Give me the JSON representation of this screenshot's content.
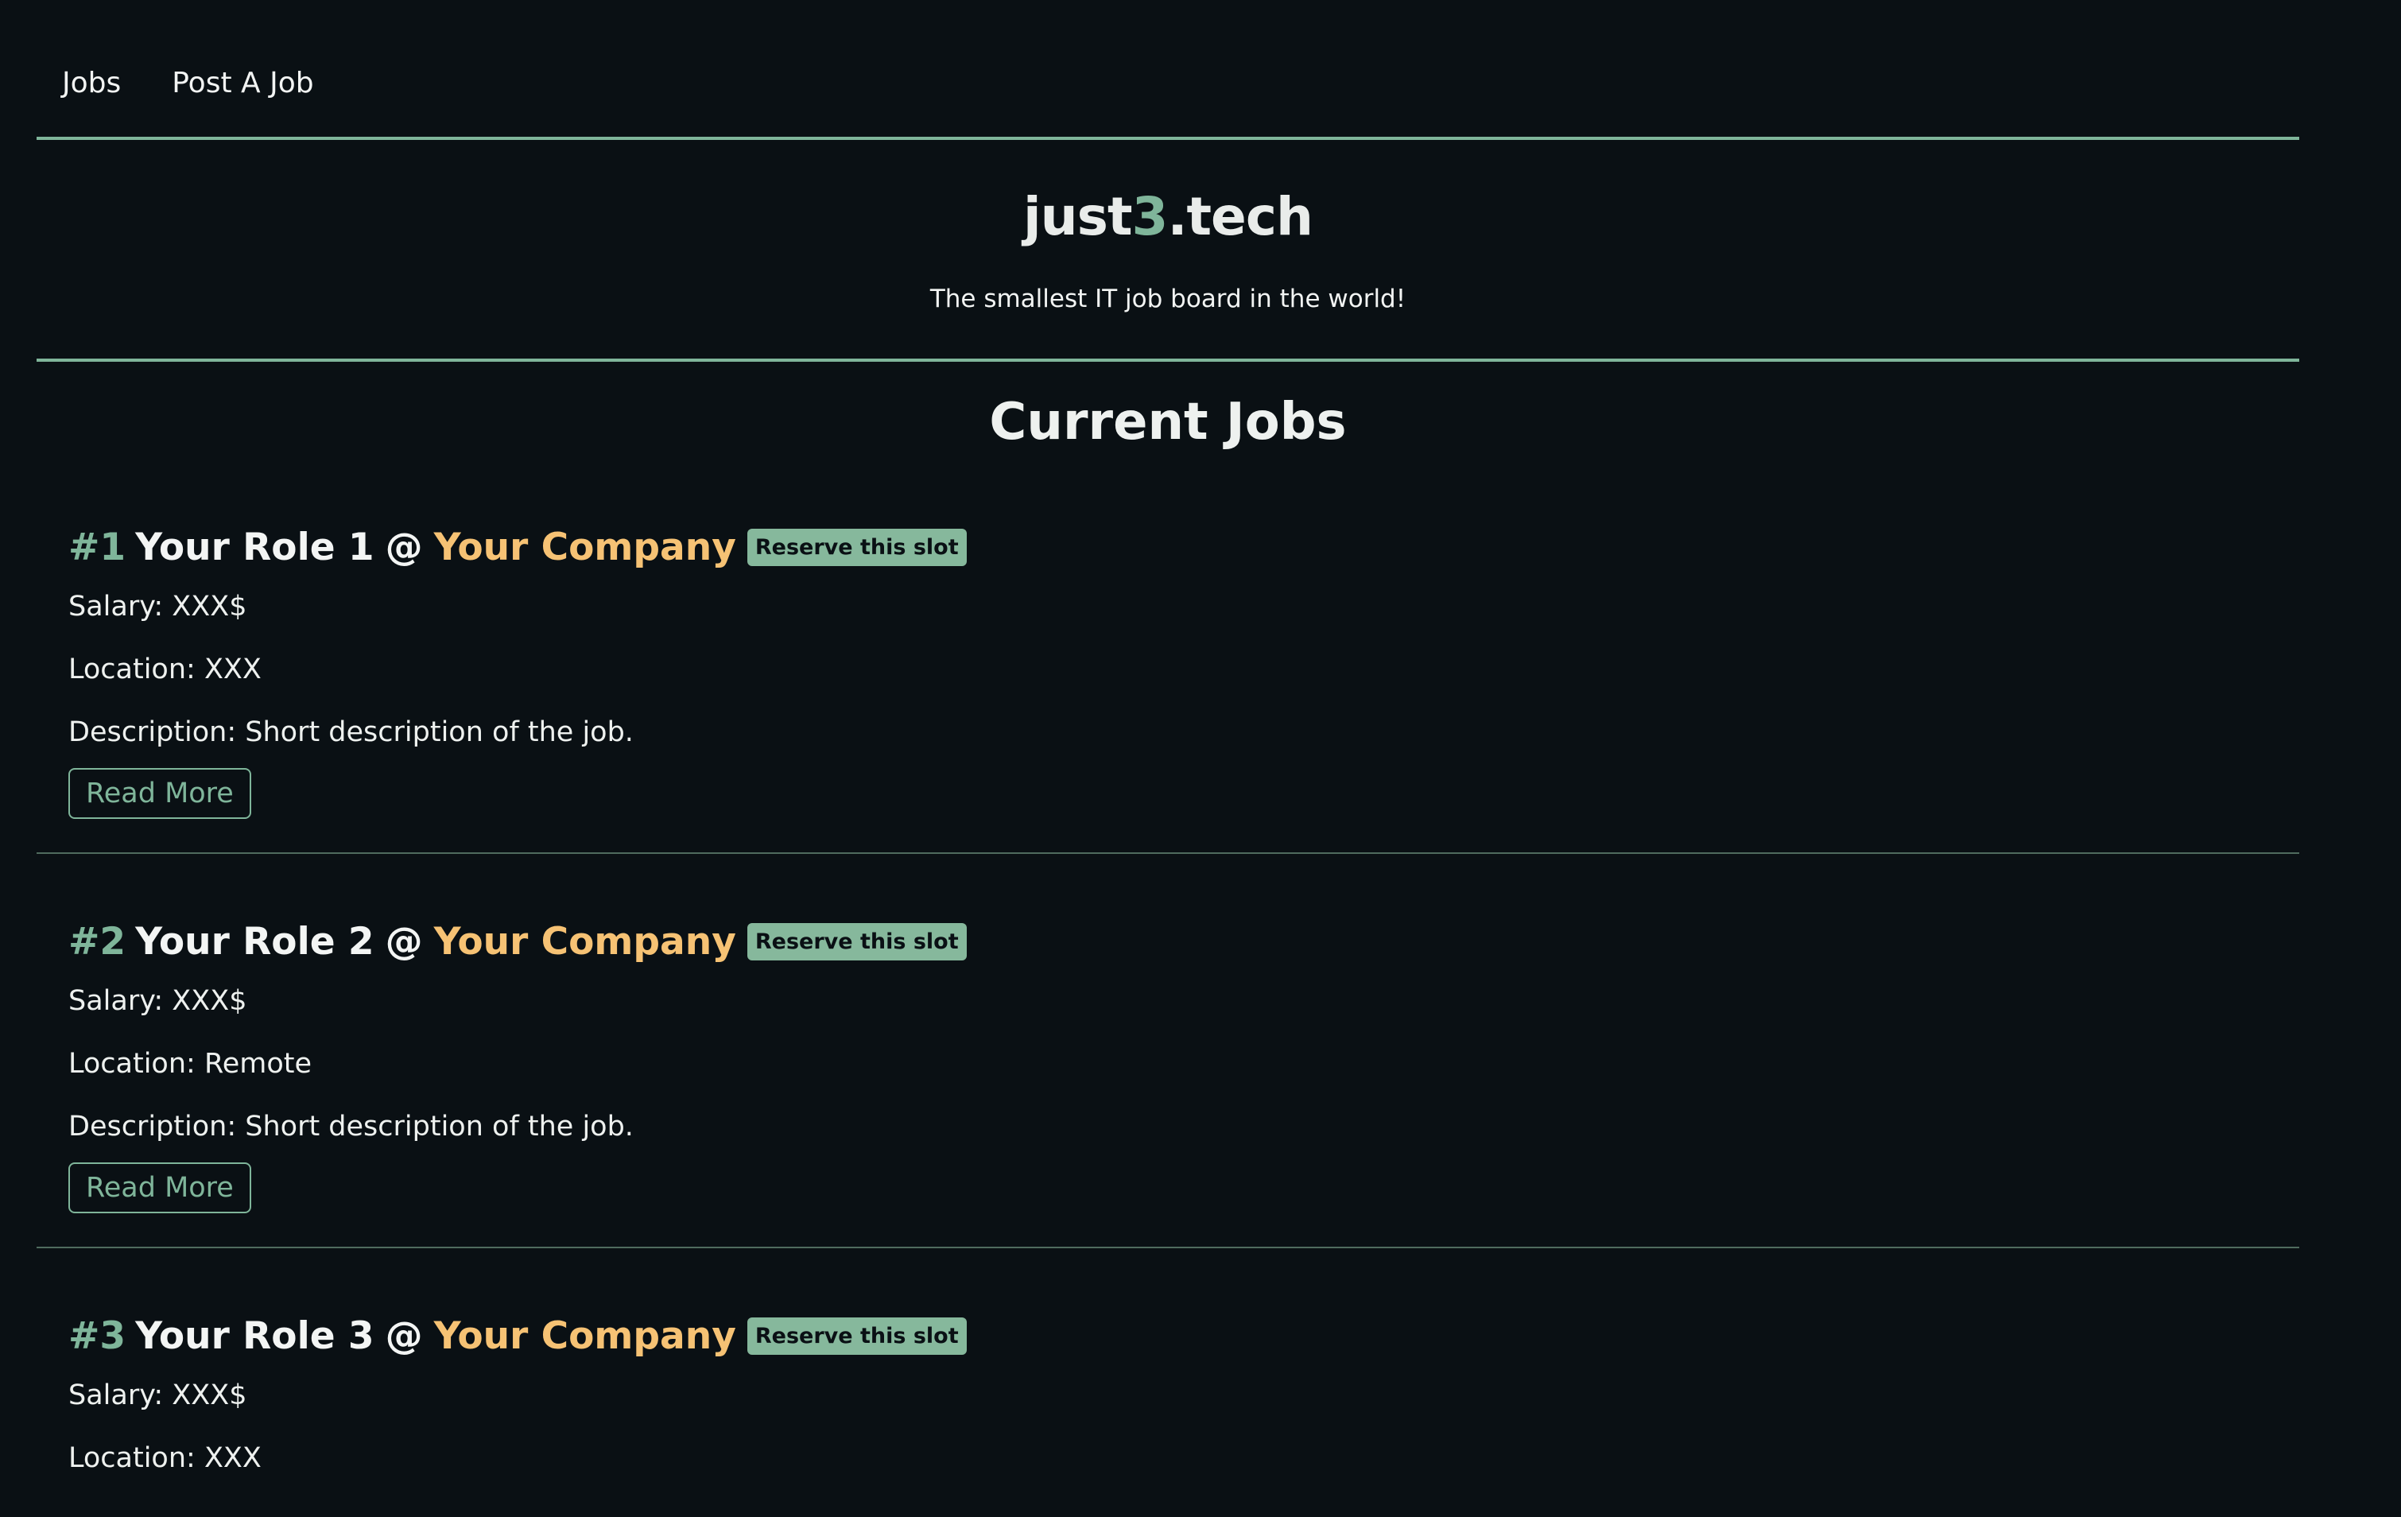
{
  "nav": {
    "jobs_label": "Jobs",
    "post_label": "Post A Job"
  },
  "brand": {
    "prefix": "just",
    "accent": "3",
    "suffix": ".tech",
    "tagline": "The smallest IT job board in the world!"
  },
  "section": {
    "title": "Current Jobs"
  },
  "jobs": [
    {
      "number": "#1",
      "role": "Your Role 1",
      "at": "@",
      "company": "Your Company",
      "badge": "Reserve this slot",
      "salary": "Salary: XXX$",
      "location": "Location: XXX",
      "description": "Description: Short description of the job.",
      "read_more": "Read More"
    },
    {
      "number": "#2",
      "role": "Your Role 2",
      "at": "@",
      "company": "Your Company",
      "badge": "Reserve this slot",
      "salary": "Salary: XXX$",
      "location": "Location: Remote",
      "description": "Description: Short description of the job.",
      "read_more": "Read More"
    },
    {
      "number": "#3",
      "role": "Your Role 3",
      "at": "@",
      "company": "Your Company",
      "badge": "Reserve this slot",
      "salary": "Salary: XXX$",
      "location": "Location: XXX"
    }
  ],
  "colors": {
    "background": "#0a1014",
    "accent_green": "#7fb59a",
    "company_gold": "#f6c274",
    "text": "#eef1ef"
  }
}
